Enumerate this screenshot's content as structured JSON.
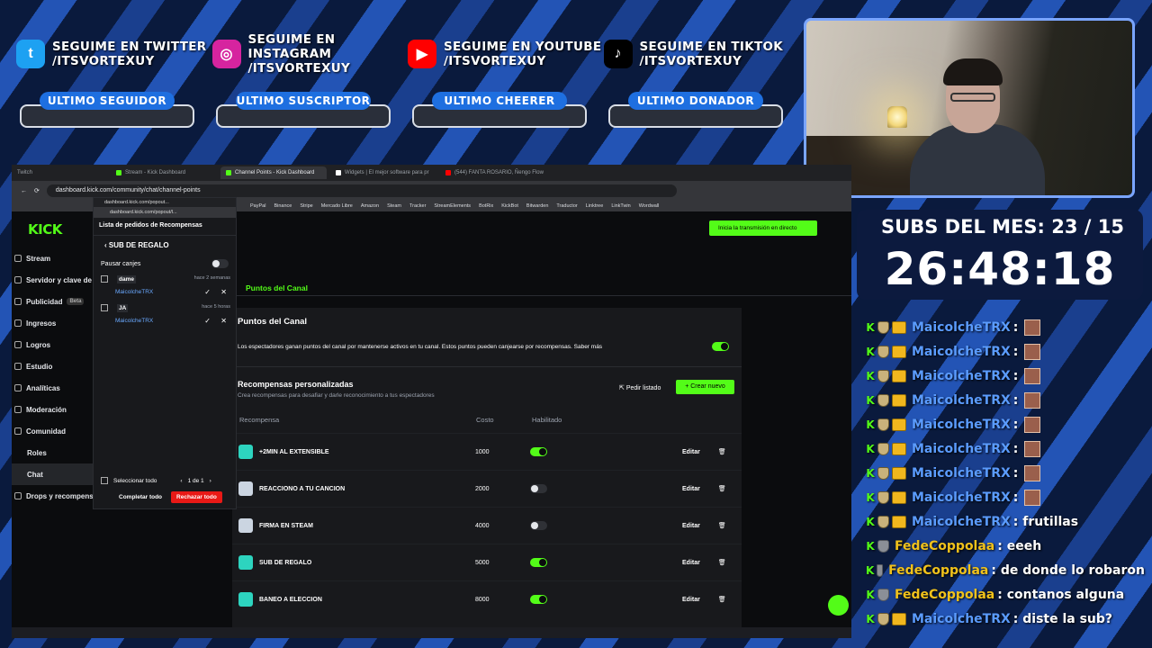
{
  "overlay": {
    "socials": [
      {
        "icon": "twitter-icon",
        "color": "#1da1f2",
        "glyph": "t",
        "line1": "SEGUIME EN TWITTER",
        "line2": "/ITSVORTEXUY"
      },
      {
        "icon": "instagram-icon",
        "color": "#d6249f",
        "glyph": "◎",
        "line1": "SEGUIME EN INSTAGRAM",
        "line2": "/ITSVORTEXUY"
      },
      {
        "icon": "youtube-icon",
        "color": "#ff0000",
        "glyph": "▶",
        "line1": "SEGUIME EN YOUTUBE",
        "line2": "/ITSVORTEXUY"
      },
      {
        "icon": "tiktok-icon",
        "color": "#000000",
        "glyph": "♪",
        "line1": "SEGUIME EN TIKTOK",
        "line2": "/ITSVORTEXUY"
      }
    ],
    "labels": [
      "ULTIMO SEGUIDOR",
      "ULTIMO SUSCRIPTOR",
      "ULTIMO CHEERER",
      "ULTIMO DONADOR"
    ],
    "subs_title": "SUBS DEL MES: 23 / 15",
    "timer": "26:48:18"
  },
  "chat": [
    {
      "user": "MaicolcheTRX",
      "text": ":",
      "crown": true,
      "emote": true,
      "color": "#5b9cff"
    },
    {
      "user": "MaicolcheTRX",
      "text": ":",
      "crown": true,
      "emote": true,
      "color": "#5b9cff"
    },
    {
      "user": "MaicolcheTRX",
      "text": ":",
      "crown": true,
      "emote": true,
      "color": "#5b9cff"
    },
    {
      "user": "MaicolcheTRX",
      "text": ":",
      "crown": true,
      "emote": true,
      "color": "#5b9cff"
    },
    {
      "user": "MaicolcheTRX",
      "text": ":",
      "crown": true,
      "emote": true,
      "color": "#5b9cff"
    },
    {
      "user": "MaicolcheTRX",
      "text": ":",
      "crown": true,
      "emote": true,
      "color": "#5b9cff"
    },
    {
      "user": "MaicolcheTRX",
      "text": ":",
      "crown": true,
      "emote": true,
      "color": "#5b9cff"
    },
    {
      "user": "MaicolcheTRX",
      "text": ":",
      "crown": true,
      "emote": true,
      "color": "#5b9cff"
    },
    {
      "user": "MaicolcheTRX",
      "text": ": frutillas",
      "crown": true,
      "emote": false,
      "color": "#5b9cff"
    },
    {
      "user": "FedeCoppolaa",
      "text": ": eeeh",
      "crown": false,
      "emote": false,
      "color": "#f1c21b"
    },
    {
      "user": "FedeCoppolaa",
      "text": ": de donde lo robaron",
      "crown": false,
      "emote": false,
      "color": "#f1c21b"
    },
    {
      "user": "FedeCoppolaa",
      "text": ": contanos alguna",
      "crown": false,
      "emote": false,
      "color": "#f1c21b"
    },
    {
      "user": "MaicolcheTRX",
      "text": ": diste la sub?",
      "crown": true,
      "emote": false,
      "color": "#5b9cff"
    }
  ],
  "browser": {
    "profile": "Twitch",
    "tabs": [
      "Stream - Kick Dashboard",
      "Channel Points - Kick Dashboard",
      "Widgets | El mejor software para pr",
      "(544) FANTA ROSARIO, Ñengo Flow"
    ],
    "url": "dashboard.kick.com/community/chat/channel-points",
    "bookmarks": [
      "PayPal",
      "Binance",
      "Stripe",
      "Mercado Libre",
      "Amazon",
      "Steam",
      "Tracker",
      "StreamElements",
      "BotRix",
      "KickBot",
      "Bitwarden",
      "Traductor",
      "Linktree",
      "LinkTwin",
      "Wordwall"
    ]
  },
  "kick": {
    "logo": "KICK",
    "live_button": "Inicia la transmisión en directo",
    "sidebar": [
      {
        "label": "Stream",
        "sub": false
      },
      {
        "label": "Servidor y clave de re",
        "sub": false
      },
      {
        "label": "Publicidad",
        "sub": false,
        "badge": "Beta"
      },
      {
        "label": "Ingresos",
        "sub": false
      },
      {
        "label": "Logros",
        "sub": false
      },
      {
        "label": "Estudio",
        "sub": false
      },
      {
        "label": "Analíticas",
        "sub": false
      },
      {
        "label": "Moderación",
        "sub": false
      },
      {
        "label": "Comunidad",
        "sub": false
      },
      {
        "label": "Roles",
        "sub": true
      },
      {
        "label": "Chat",
        "sub": true,
        "active": true
      },
      {
        "label": "Drops y recompens",
        "sub": false
      }
    ],
    "section_tab": "Puntos del Canal",
    "card_title": "Puntos del Canal",
    "card_desc": "Los espectadores ganan puntos del canal por mantenerse activos en tu canal. Estos puntos pueden canjearse por recompensas. Saber más",
    "rewards_title": "Recompensas personalizadas",
    "rewards_sub": "Crea recompensas para desafiar y darle reconocimiento a tus espectadores",
    "list_button": "Pedir listado",
    "new_button": "+ Crear nuevo",
    "cols": [
      "Recompensa",
      "Costo",
      "Habilitado"
    ],
    "rewards": [
      {
        "name": "+2MIN AL EXTENSIBLE",
        "cost": "1000",
        "enabled": true,
        "icon_color": "teal"
      },
      {
        "name": "REACCIONO A TU CANCION",
        "cost": "2000",
        "enabled": false,
        "icon_color": "grey"
      },
      {
        "name": "FIRMA EN STEAM",
        "cost": "4000",
        "enabled": false,
        "icon_color": "grey"
      },
      {
        "name": "SUB DE REGALO",
        "cost": "5000",
        "enabled": true,
        "icon_color": "teal"
      },
      {
        "name": "BANEO A ELECCION",
        "cost": "8000",
        "enabled": true,
        "icon_color": "teal"
      }
    ],
    "edit_label": "Editar"
  },
  "popout": {
    "window_title": "dashboard.kick.com/popout...",
    "addr": "dashboard.kick.com/popout/l...",
    "header": "Lista de pedidos de Recompensas",
    "back_label": "SUB DE REGALO",
    "pause_label": "Pausar canjes",
    "requests": [
      {
        "msg": "dame",
        "ago": "hace 2 semanas",
        "user": "MaicolcheTRX"
      },
      {
        "msg": "JA",
        "ago": "hace 5 horas",
        "user": "MaicolcheTRX"
      }
    ],
    "select_all": "Seleccionar todo",
    "pagination": "1 de 1",
    "complete_all": "Completar todo",
    "reject_all": "Rechazar todo"
  }
}
